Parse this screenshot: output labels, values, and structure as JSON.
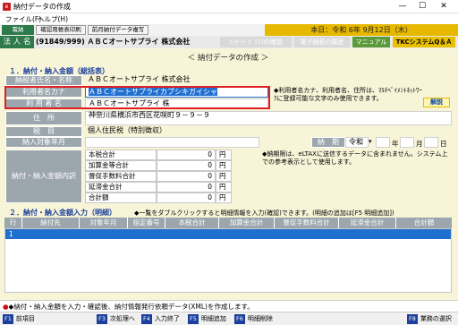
{
  "window": {
    "title": "納付データの作成",
    "minimize": "—",
    "maximize": "☐",
    "close": "✕"
  },
  "menu": {
    "file": "ファイル(F)",
    "help": "ヘルプ(H)"
  },
  "toolbar": {
    "left_tab": "電納",
    "print_btn": "確認用帳表印刷",
    "prev_btn": "前月納付データ複写",
    "date": "本日：令和 6年 9月12日（木）"
  },
  "header": {
    "houjin": "法 人 名",
    "company": "(91849/999) ＡＢＣオートサプライ 株式会社",
    "msgbox": "ﾒｯｾｰｼﾞﾎﾞｯｸｽの確認",
    "history": "電子納税の履歴",
    "manual": "マニュアル",
    "tkc": "TKCシステムQ＆Ａ"
  },
  "page_subtitle": "＜ 納付データの作成 ＞",
  "section1": {
    "title": "１．納付・納入金額（総括表）",
    "rows": {
      "payer_label": "納税者氏名・名称",
      "payer_value": "ＡＢＣオートサプライ 株式会社",
      "kana_label": "利用者名カナ",
      "kana_value": "ＡＢＣオートサプライカブシキガイシャ",
      "user_label": "利 用 者 名",
      "user_value": "ＡＢＣオートサプライ 株",
      "address_label": "住　所",
      "address_value": "神奈川県横浜市西区花咲町９－９－９",
      "tax_label": "税　目",
      "tax_value": "個人住民税（特別徴収）",
      "period_label": "納入対象年月",
      "deadline_label": "納　期　限",
      "era": "令和",
      "year_unit": "年",
      "month_unit": "月",
      "day_unit": "日",
      "breakdown_label": "納付・納入金額内訳"
    },
    "note1": "◆利用者名カナ、利用者名、住所は、ﾏﾙﾁﾍﾟｲﾒﾝﾄﾈｯﾄﾜｰｸに登録可能な文字のみ使用できます。",
    "explain": "解説",
    "note2": "◆納期限は、eLTAXに送信するデータに含まれません。システム上での参考表示として使用します。",
    "breakdown": [
      {
        "label": "本税合計",
        "value": "0",
        "unit": "円"
      },
      {
        "label": "加算金等合計",
        "value": "0",
        "unit": "円"
      },
      {
        "label": "督促手数料合計",
        "value": "0",
        "unit": "円"
      },
      {
        "label": "延滞金合計",
        "value": "0",
        "unit": "円"
      },
      {
        "label": "合計額",
        "value": "0",
        "unit": "円"
      }
    ]
  },
  "section2": {
    "title": "２．納付・納入金額入力（明細）",
    "hint": "◆一覧をダブルクリックすると明細情報を入力(確認)できます。(明細の追加は[F5 明細追加])",
    "columns": [
      "行",
      "納付先",
      "対象年月",
      "指定番号",
      "本税合計",
      "加算金合計",
      "督促手数料合計",
      "延滞金合計",
      "合計額"
    ],
    "first_row_no": "1"
  },
  "status": "◆納付・納入金額を入力・確認後、納付情報発行依頼データ(XML)を作成します。",
  "fkeys": [
    {
      "key": "F1",
      "label": "前項目"
    },
    {
      "key": "F3",
      "label": "次処理へ"
    },
    {
      "key": "F4",
      "label": "入力終了"
    },
    {
      "key": "F5",
      "label": "明細追加"
    },
    {
      "key": "F6",
      "label": "明細削除"
    },
    {
      "key": "F8",
      "label": "業務の選択"
    }
  ]
}
